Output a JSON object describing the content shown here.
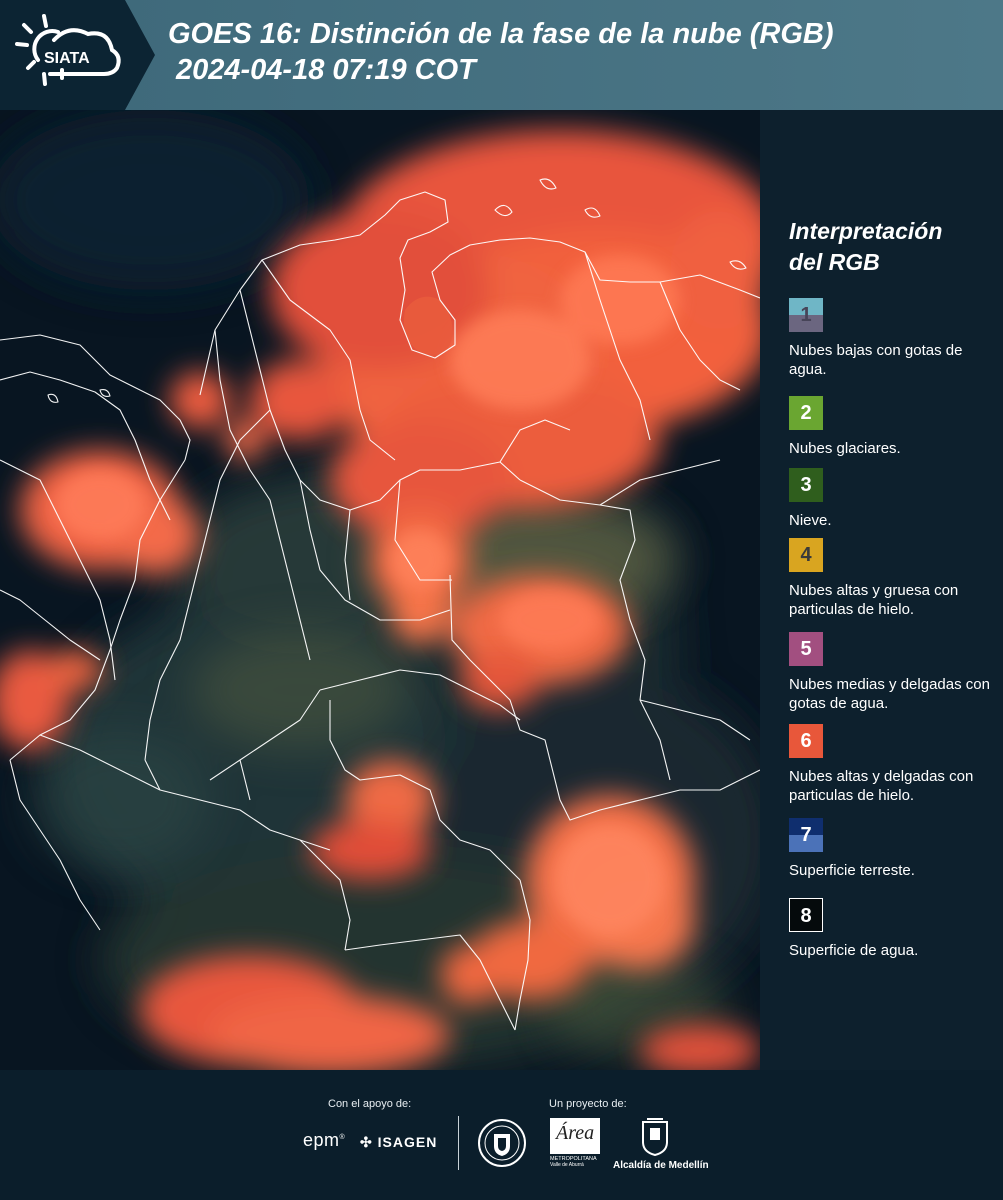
{
  "header": {
    "logo_text": "SIATA",
    "title_line1": "GOES 16: Distinción de la fase de la nube (RGB)",
    "title_line2": "2024-04-18 07:19 COT"
  },
  "map": {
    "product": "satellite-rgb-cloud-phase",
    "background_color": "#07131f",
    "cloud_color": "#f2603d",
    "border_color": "#ffffff"
  },
  "legend": {
    "title_line1": "Interpretación",
    "title_line2": "del RGB",
    "items": [
      {
        "number": "1",
        "label": "Nubes bajas con gotas de agua.",
        "color_top": "#6fb6c6",
        "color_bottom": "#6b6680",
        "number_color": "#474458"
      },
      {
        "number": "2",
        "label": "Nubes glaciares.",
        "color_top": "#6aa631",
        "color_bottom": "#6aa631",
        "number_color": "#ffffff"
      },
      {
        "number": "3",
        "label": "Nieve.",
        "color_top": "#2f5e1d",
        "color_bottom": "#2f5e1d",
        "number_color": "#ffffff"
      },
      {
        "number": "4",
        "label": "Nubes altas y gruesa con particulas de hielo.",
        "color_top": "#d9a520",
        "color_bottom": "#d9a520",
        "number_color": "#3a3a3a"
      },
      {
        "number": "5",
        "label": "Nubes medias y delgadas con gotas de agua.",
        "color_top": "#a24f80",
        "color_bottom": "#a24f80",
        "number_color": "#ffffff"
      },
      {
        "number": "6",
        "label": "Nubes altas y delgadas con particulas de hielo.",
        "color_top": "#e8573a",
        "color_bottom": "#e8573a",
        "number_color": "#ffffff"
      },
      {
        "number": "7",
        "label": "Superficie terreste.",
        "color_top": "#0f2e6e",
        "color_bottom": "#4b72b8",
        "number_color": "#ffffff"
      },
      {
        "number": "8",
        "label": "Superficie de agua.",
        "color_top": "#050a0c",
        "color_bottom": "#050a0c",
        "number_color": "#ffffff"
      }
    ]
  },
  "footer": {
    "support_label": "Con el apoyo de:",
    "project_label": "Un proyecto de:",
    "sponsor_epm": "epm",
    "sponsor_isagen": "ISAGEN",
    "area_logo_text": "Área",
    "area_logo_sub": "METROPOLITANA",
    "area_logo_sub2": "Valle de Aburrá",
    "alcaldia": "Alcaldía de Medellín"
  }
}
